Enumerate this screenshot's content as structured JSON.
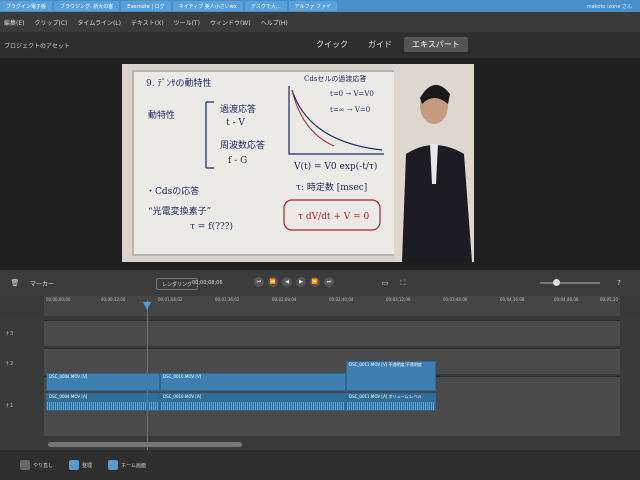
{
  "browser": {
    "tabs": [
      "プラグイン電子版",
      "ブラウジング: 新大の客",
      "Evernote | ログ",
      "ネイティブ 美人小さいwx",
      "デスクで大...",
      "アルファ ファイ",
      "makoto izone さん"
    ]
  },
  "menubar": {
    "items": [
      "編集(E)",
      "クリップ(C)",
      "タイムライン(L)",
      "テキスト(X)",
      "ツール(T)",
      "ウィンドウ(W)",
      "ヘルプ(H)"
    ]
  },
  "modebar": {
    "project_assets": "プロジェクトのアセット",
    "tabs": [
      {
        "label": "クイック"
      },
      {
        "label": "ガイド"
      },
      {
        "label": "エキスパート"
      }
    ]
  },
  "whiteboard": {
    "lines": [
      "9. ﾃﾞﾝｻの動特性",
      "動特性",
      "過渡応答",
      "t - V",
      "周波数応答",
      "f - G",
      "・Cdsの応答",
      "“光電変換素子”",
      "τ = f(???)",
      "V(t) = V0 exp(-t/τ)",
      "τ: 時定数 [msec]",
      "τ dV/dt + V = 0",
      "Cdsセルの過渡応答",
      "t=0 → V=V0",
      "t=∞ → V=0"
    ]
  },
  "timeline_toolbar": {
    "marker_label": "マーカー",
    "render_label": "レンダリング",
    "timecode": "00;00;08;06"
  },
  "ruler": {
    "labels": [
      "00;00;00;00",
      "00;00;32;00",
      "00;01;04;02",
      "00;01;36;02",
      "00;02;08;04",
      "00;02;40;04",
      "00;03;12;06",
      "00;03;44;06",
      "00;04;16;08",
      "00;04;48;08",
      "00;05;20"
    ]
  },
  "tracks": {
    "heads": [
      "ｵ 3",
      "ｵ 2",
      "ｵ 1"
    ],
    "clips": [
      {
        "label": "DSC_0004.MOV [V]",
        "kind": "video"
      },
      {
        "label": "DSC_0010.MOV [V]",
        "kind": "video"
      },
      {
        "label": "DSC_0011.MOV [V] 不透明度:不透明度",
        "kind": "video"
      },
      {
        "label": "DSC_0004.MOV [A]",
        "kind": "audio"
      },
      {
        "label": "DSC_0010.MOV [A]",
        "kind": "audio"
      },
      {
        "label": "DSC_0011.MOV [A] ボリューム:レベル",
        "kind": "audio"
      }
    ]
  },
  "bottombar": {
    "items": [
      "やり直し",
      "整理",
      "ホーム画面"
    ]
  },
  "colors": {
    "clip_video": "#3d7fb0",
    "clip_audio": "#2d6e9a",
    "playhead": "#e04040",
    "whiteboard_ink": "#1c2a60"
  }
}
